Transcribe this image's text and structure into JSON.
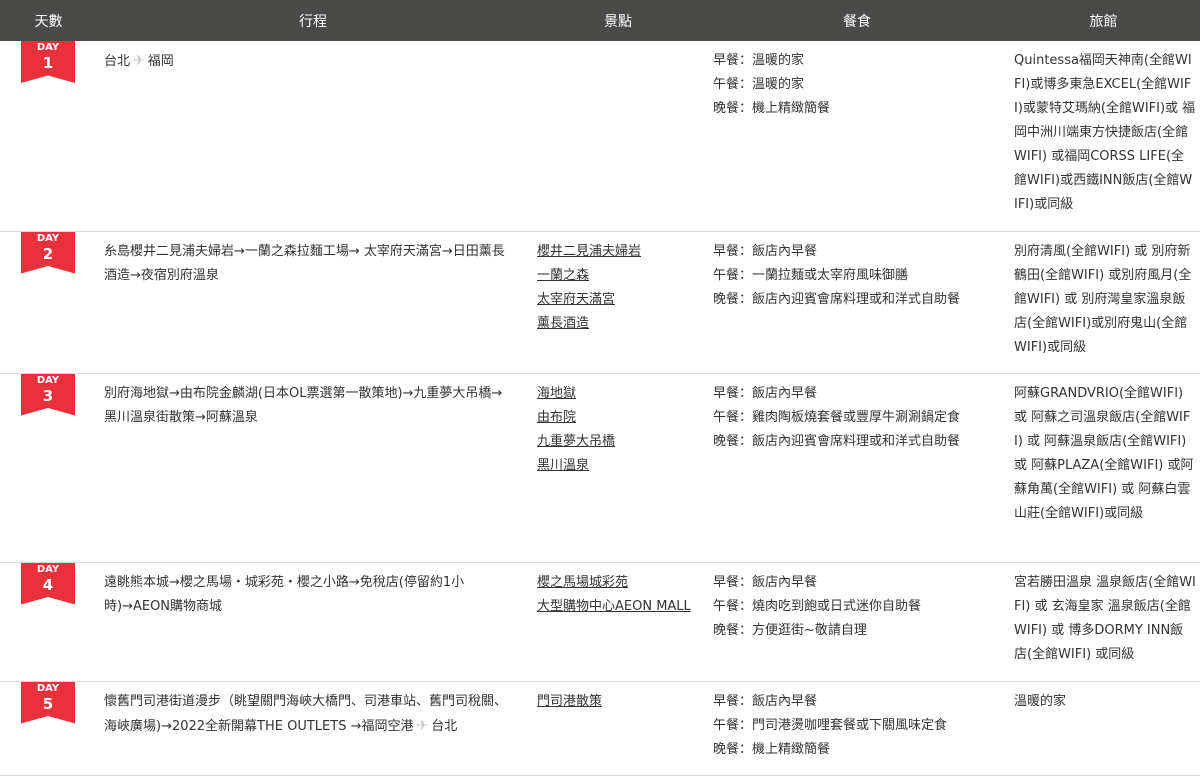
{
  "headers": {
    "day": "天數",
    "route": "行程",
    "spots": "景點",
    "meals": "餐食",
    "hotel": "旅館"
  },
  "day_label": "DAY",
  "days": [
    {
      "num": "1",
      "route_from": "台北",
      "route_to": "福岡",
      "spots": [],
      "meals": [
        "早餐：溫暖的家",
        "午餐：溫暖的家",
        "晚餐：機上精緻簡餐"
      ],
      "hotel": "Quintessa福岡天神南(全館WIFI)或博多東急EXCEL(全館WIFI)或蒙特艾瑪納(全館WIFI)或 福岡中洲川端東方快捷飯店(全館WIFI) 或福岡CORSS LIFE(全館WIFI)或西鐵INN飯店(全館WIFI)或同級"
    },
    {
      "num": "2",
      "route": "糸島櫻井二見浦夫婦岩→一蘭之森拉麵工場→ 太宰府天滿宮→日田薰長酒造→夜宿別府溫泉",
      "spots": [
        "櫻井二見浦夫婦岩",
        "一蘭之森",
        "太宰府天滿宮",
        "薰長酒造"
      ],
      "meals": [
        "早餐：飯店內早餐",
        "午餐：一蘭拉麵或太宰府風味御膳",
        "晚餐：飯店內迎賓會席料理或和洋式自助餐"
      ],
      "hotel": "別府清風(全館WIFI) 或 別府新鶴田(全館WIFI) 或別府風月(全館WIFI) 或 別府灣皇家溫泉飯店(全館WIFI)或別府鬼山(全館WIFI)或同級"
    },
    {
      "num": "3",
      "route": "別府海地獄→由布院金麟湖(日本OL票選第一散策地)→九重夢大吊橋→黑川溫泉街散策→阿蘇溫泉",
      "spots": [
        "海地獄",
        "由布院",
        "九重夢大吊橋",
        "黑川溫泉"
      ],
      "meals": [
        "早餐：飯店內早餐",
        "午餐：雞肉陶板燒套餐或豐厚牛涮涮鍋定食",
        "晚餐：飯店內迎賓會席料理或和洋式自助餐"
      ],
      "hotel": "阿蘇GRANDVRIO(全館WIFI) 或 阿蘇之司溫泉飯店(全館WIFI) 或 阿蘇溫泉飯店(全館WIFI) 或 阿蘇PLAZA(全館WIFI) 或阿蘇角萬(全館WIFI) 或 阿蘇白雲山莊(全館WIFI)或同級"
    },
    {
      "num": "4",
      "route": "遠眺熊本城→櫻之馬場・城彩苑・櫻之小路→免稅店(停留約1小時)→AEON購物商城",
      "spots": [
        "櫻之馬場城彩苑",
        "大型購物中心AEON MALL"
      ],
      "meals": [
        "早餐：飯店內早餐",
        "午餐：燒肉吃到飽或日式迷你自助餐",
        "晚餐：方便逛街~敬請自理"
      ],
      "hotel": "宮若勝田溫泉 溫泉飯店(全館WIFI) 或 玄海皇家 溫泉飯店(全館WIFI) 或 博多DORMY INN飯店(全館WIFI) 或同級"
    },
    {
      "num": "5",
      "route_main": "懷舊門司港街道漫步（眺望關門海峽大橋門、司港車站、舊門司稅關、海峽廣場)→2022全新開幕THE OUTLETS →福岡空港",
      "route_end": "台北",
      "spots": [
        "門司港散策"
      ],
      "meals": [
        "早餐：飯店內早餐",
        "午餐：門司港燙咖哩套餐或下關風味定食",
        "晚餐：機上精緻簡餐"
      ],
      "hotel": "溫暖的家"
    }
  ]
}
